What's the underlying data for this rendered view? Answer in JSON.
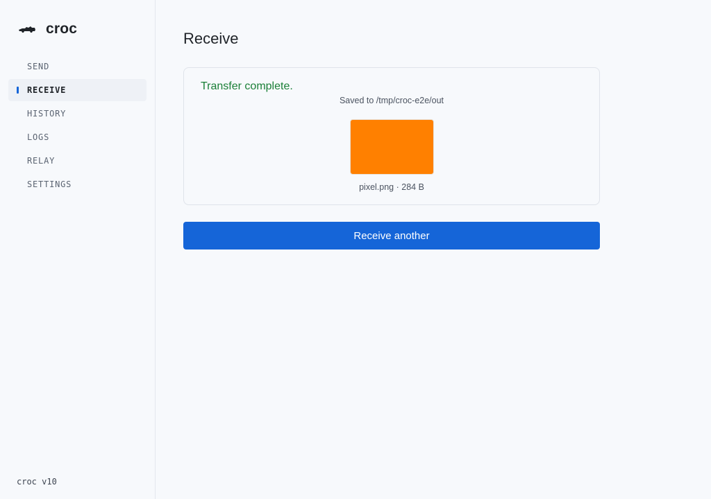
{
  "app": {
    "name": "croc",
    "version": "croc v10"
  },
  "sidebar": {
    "items": [
      {
        "label": "SEND",
        "active": false
      },
      {
        "label": "RECEIVE",
        "active": true
      },
      {
        "label": "HISTORY",
        "active": false
      },
      {
        "label": "LOGS",
        "active": false
      },
      {
        "label": "RELAY",
        "active": false
      },
      {
        "label": "SETTINGS",
        "active": false
      }
    ]
  },
  "main": {
    "title": "Receive",
    "result": {
      "status": "Transfer complete.",
      "saved_path": "Saved to /tmp/croc-e2e/out",
      "file_meta": "pixel.png · 284 B",
      "preview_color": "#ff8000"
    },
    "button_label": "Receive another"
  },
  "colors": {
    "accent": "#1565d8",
    "success": "#1a7f37"
  },
  "icons": {
    "logo": "crocodile-icon"
  }
}
